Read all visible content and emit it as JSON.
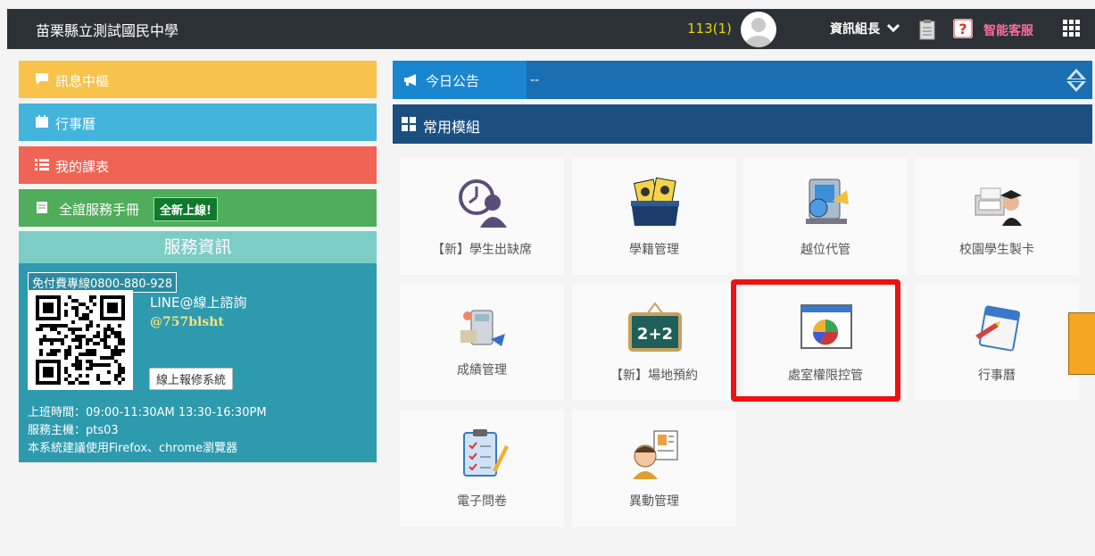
{
  "topbar": {
    "school_name": "苗栗縣立測試國民中學",
    "term": "113(1)",
    "role": "資訊組長",
    "support": "智能客服",
    "icons": [
      "avatar-icon",
      "chevron-down-icon",
      "clipboard-icon",
      "help-icon",
      "grid-menu-icon"
    ]
  },
  "left_menu": {
    "messages": "訊息中樞",
    "calendar": "行事曆",
    "timetable": "我的課表",
    "manual": "全誼服務手冊",
    "manual_badge": "全新上線!"
  },
  "service": {
    "title": "服務資訊",
    "hotline": "免付費專線0800-880-928",
    "line_label": "LINE@線上諮詢",
    "line_id": "@757blsht",
    "repair_button": "線上報修系統",
    "hours": "上班時間：09:00-11:30AM 13:30-16:30PM",
    "host": "服務主機：pts03",
    "browser": "本系統建議使用Firefox、chrome瀏覽器"
  },
  "announcement": {
    "label": "今日公告",
    "text": "--"
  },
  "modules": {
    "title": "常用模組",
    "items": [
      {
        "label": "【新】學生出缺席",
        "icon": "attendance-icon"
      },
      {
        "label": "學籍管理",
        "icon": "records-icon"
      },
      {
        "label": "越位代管",
        "icon": "proxy-icon"
      },
      {
        "label": "校園學生製卡",
        "icon": "student-card-icon"
      },
      {
        "label": "成績管理",
        "icon": "grades-icon"
      },
      {
        "label": "【新】場地預約",
        "icon": "venue-icon"
      },
      {
        "label": "處室權限控管",
        "icon": "permissions-icon"
      },
      {
        "label": "行事曆",
        "icon": "calendar-icon"
      },
      {
        "label": "電子問卷",
        "icon": "survey-icon"
      },
      {
        "label": "異動管理",
        "icon": "transfer-icon"
      }
    ]
  },
  "colors": {
    "topbar": "#2b3137",
    "messages": "#f8c34a",
    "calendar": "#43b4dc",
    "timetable": "#ef6455",
    "manual": "#4fad5b",
    "highlight": "#ee1111"
  }
}
